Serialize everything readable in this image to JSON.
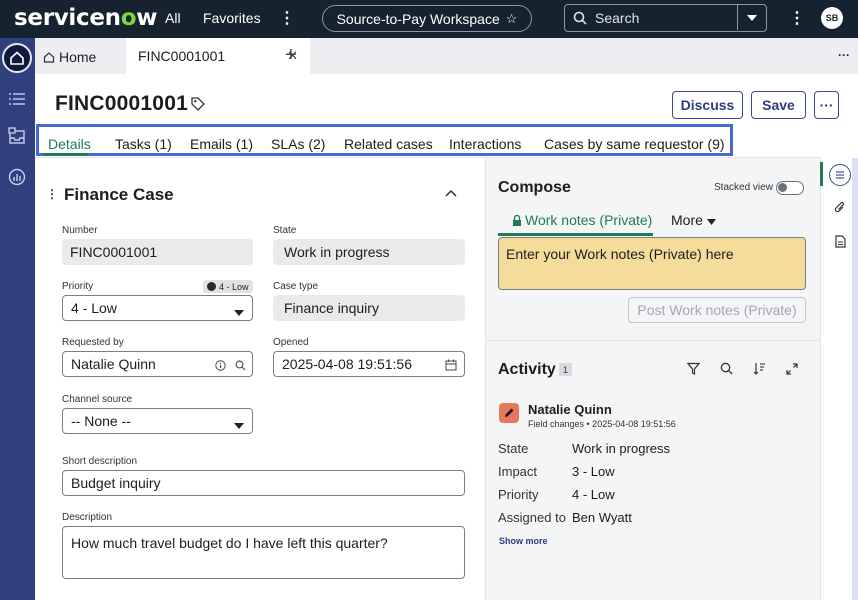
{
  "topbar": {
    "logo_text_1": "servicen",
    "logo_text_2": "o",
    "logo_text_3": "w",
    "all_label": "All",
    "favorites_label": "Favorites",
    "workspace_label": "Source-to-Pay Workspace",
    "search_label": "Search",
    "avatar_initials": "SB"
  },
  "tabs": {
    "home_label": "Home",
    "active_label": "FINC0001001"
  },
  "record": {
    "title": "FINC0001001",
    "discuss_label": "Discuss",
    "save_label": "Save",
    "more_label": "···"
  },
  "subtabs": [
    {
      "label": "Details",
      "active": true
    },
    {
      "label": "Tasks (1)"
    },
    {
      "label": "Emails (1)"
    },
    {
      "label": "SLAs (2)"
    },
    {
      "label": "Related cases"
    },
    {
      "label": "Interactions"
    },
    {
      "label": "Cases by same requestor (9)"
    }
  ],
  "form": {
    "section_title": "Finance Case",
    "number_label": "Number",
    "number_value": "FINC0001001",
    "state_label": "State",
    "state_value": "Work in progress",
    "priority_label": "Priority",
    "priority_badge": "4 - Low",
    "priority_value": "4 - Low",
    "case_type_label": "Case type",
    "case_type_value": "Finance inquiry",
    "requested_by_label": "Requested by",
    "requested_by_value": "Natalie Quinn",
    "opened_label": "Opened",
    "opened_value": "2025-04-08 19:51:56",
    "channel_label": "Channel source",
    "channel_value": "-- None --",
    "short_desc_label": "Short description",
    "short_desc_value": "Budget inquiry",
    "desc_label": "Description",
    "desc_value": "How much travel budget do I have left this quarter?"
  },
  "compose": {
    "title": "Compose",
    "stacked_label": "Stacked view",
    "work_notes_tab": "Work notes (Private)",
    "more_tab": "More",
    "placeholder": "Enter your Work notes (Private) here",
    "post_label": "Post Work notes (Private)"
  },
  "activity": {
    "title": "Activity",
    "count": "1",
    "author": "Natalie Quinn",
    "subline": "Field changes • 2025-04-08 19:51:56",
    "rows": [
      {
        "k": "State",
        "v": "Work in progress"
      },
      {
        "k": "Impact",
        "v": "3 - Low"
      },
      {
        "k": "Priority",
        "v": "4 - Low"
      },
      {
        "k": "Assigned to",
        "v": "Ben Wyatt"
      }
    ],
    "show_more": "Show more"
  }
}
